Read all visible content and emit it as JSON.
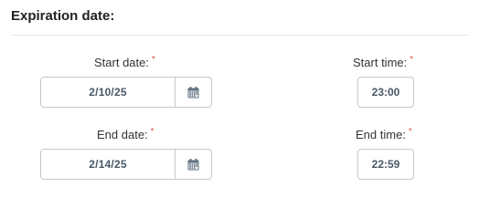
{
  "section": {
    "title": "Expiration date:"
  },
  "required_marker": "*",
  "start_date": {
    "label": "Start date:",
    "value": "2/10/25"
  },
  "start_time": {
    "label": "Start time:",
    "value": "23:00"
  },
  "end_date": {
    "label": "End date:",
    "value": "2/14/25"
  },
  "end_time": {
    "label": "End time:",
    "value": "22:59"
  },
  "icons": {
    "calendar": "calendar-icon"
  },
  "colors": {
    "required": "#d9534f",
    "value_text": "#4a5866",
    "border": "#c8c8c8"
  }
}
